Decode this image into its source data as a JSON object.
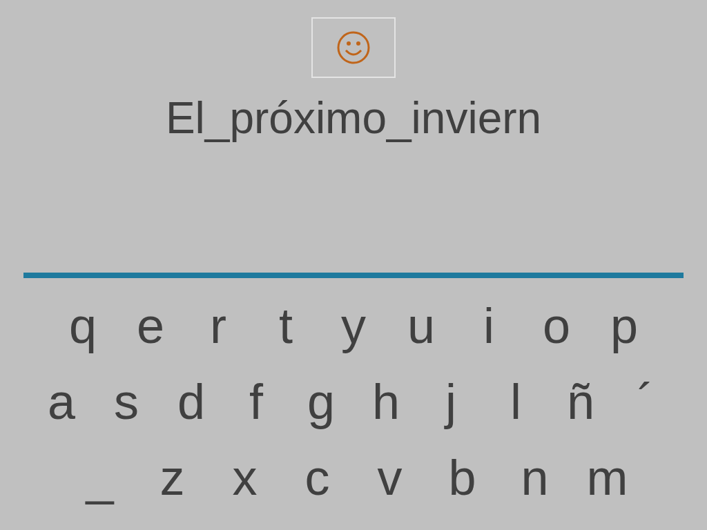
{
  "phrase": "El_próximo_inviern",
  "keyboard": [
    [
      "q",
      "e",
      "r",
      "t",
      "y",
      "u",
      "i",
      "o",
      "p"
    ],
    [
      "a",
      "s",
      "d",
      "f",
      "g",
      "h",
      "j",
      "l",
      "ñ",
      "´"
    ],
    [
      "_",
      "z",
      "x",
      "c",
      "v",
      "b",
      "n",
      "m"
    ]
  ]
}
